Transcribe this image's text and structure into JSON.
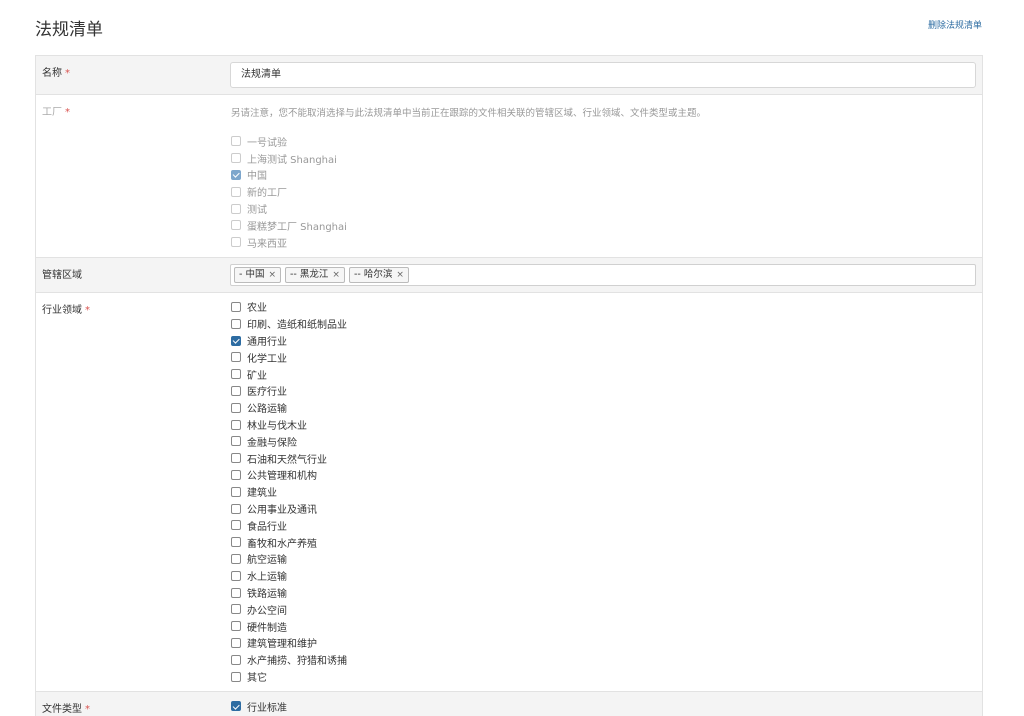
{
  "header": {
    "title": "法规清单",
    "delete_link": "删除法规清单"
  },
  "name_row": {
    "label": "名称",
    "required_mark": "*",
    "value": "法规清单"
  },
  "factory_row": {
    "label": "工厂",
    "required_mark": "*",
    "note": "另请注意，您不能取消选择与此法规清单中当前正在跟踪的文件相关联的管辖区域、行业领域、文件类型或主题。",
    "options": [
      {
        "label": "一号试验",
        "checked": false
      },
      {
        "label": "上海测试 Shanghai",
        "checked": false
      },
      {
        "label": "中国",
        "checked": true
      },
      {
        "label": "新的工厂",
        "checked": false
      },
      {
        "label": "测试",
        "checked": false
      },
      {
        "label": "蛋糕梦工厂 Shanghai",
        "checked": false
      },
      {
        "label": "马来西亚",
        "checked": false
      }
    ]
  },
  "jurisdiction_row": {
    "label": "管辖区域",
    "tags": [
      {
        "label": "- 中国",
        "remove": "×"
      },
      {
        "label": "-- 黑龙江",
        "remove": "×"
      },
      {
        "label": "-- 哈尔滨",
        "remove": "×"
      }
    ]
  },
  "industry_row": {
    "label": "行业领域",
    "required_mark": "*",
    "options": [
      {
        "label": "农业",
        "checked": false
      },
      {
        "label": "印刷、造纸和纸制品业",
        "checked": false
      },
      {
        "label": "通用行业",
        "checked": true
      },
      {
        "label": "化学工业",
        "checked": false
      },
      {
        "label": "矿业",
        "checked": false
      },
      {
        "label": "医疗行业",
        "checked": false
      },
      {
        "label": "公路运输",
        "checked": false
      },
      {
        "label": "林业与伐木业",
        "checked": false
      },
      {
        "label": "金融与保险",
        "checked": false
      },
      {
        "label": "石油和天然气行业",
        "checked": false
      },
      {
        "label": "公共管理和机构",
        "checked": false
      },
      {
        "label": "建筑业",
        "checked": false
      },
      {
        "label": "公用事业及通讯",
        "checked": false
      },
      {
        "label": "食品行业",
        "checked": false
      },
      {
        "label": "畜牧和水产养殖",
        "checked": false
      },
      {
        "label": "航空运输",
        "checked": false
      },
      {
        "label": "水上运输",
        "checked": false
      },
      {
        "label": "铁路运输",
        "checked": false
      },
      {
        "label": "办公空间",
        "checked": false
      },
      {
        "label": "硬件制造",
        "checked": false
      },
      {
        "label": "建筑管理和维护",
        "checked": false
      },
      {
        "label": "水产捕捞、狩猎和诱捕",
        "checked": false
      },
      {
        "label": "其它",
        "checked": false
      }
    ]
  },
  "doctype_row": {
    "label": "文件类型",
    "required_mark": "*",
    "options": [
      {
        "label": "行业标准",
        "checked": true
      }
    ]
  },
  "colors": {
    "accent": "#2d6ca2",
    "required": "#d9534f"
  }
}
